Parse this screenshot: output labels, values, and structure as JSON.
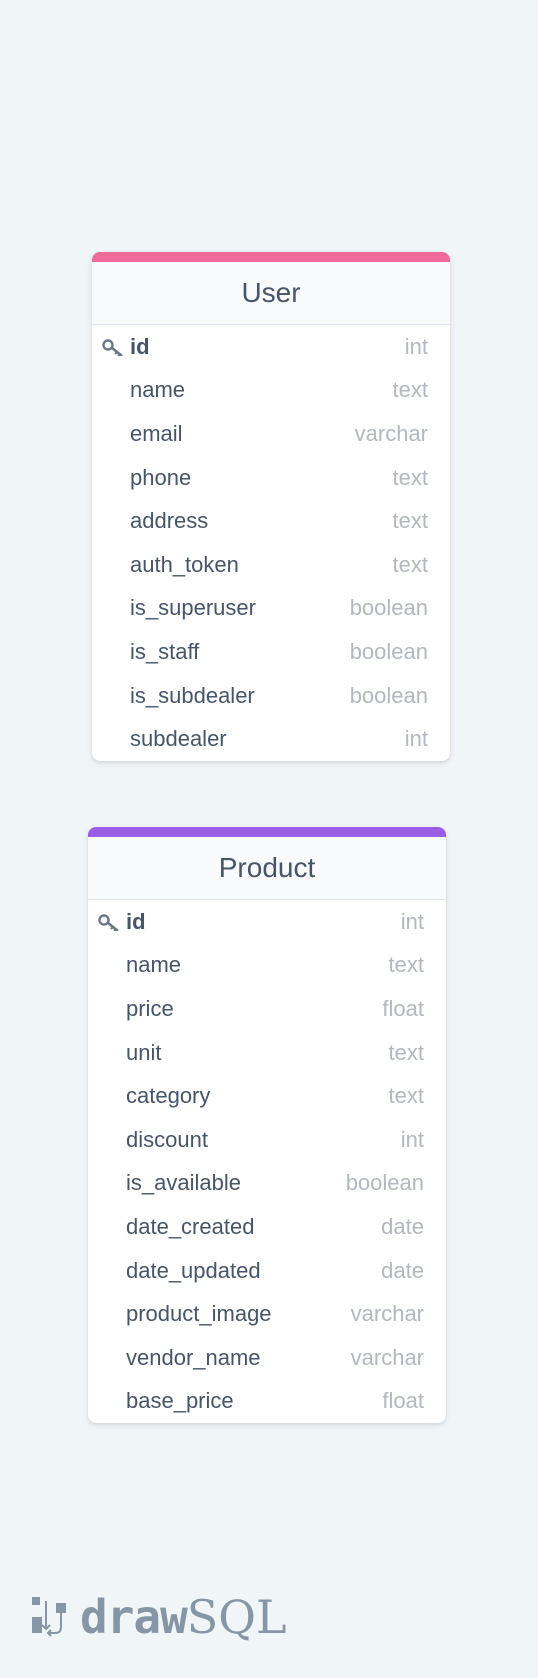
{
  "tables": [
    {
      "name": "User",
      "accent_color": "#f06a99",
      "columns": [
        {
          "name": "id",
          "type": "int",
          "pk": true
        },
        {
          "name": "name",
          "type": "text"
        },
        {
          "name": "email",
          "type": "varchar"
        },
        {
          "name": "phone",
          "type": "text"
        },
        {
          "name": "address",
          "type": "text"
        },
        {
          "name": "auth_token",
          "type": "text"
        },
        {
          "name": "is_superuser",
          "type": "boolean"
        },
        {
          "name": "is_staff",
          "type": "boolean"
        },
        {
          "name": "is_subdealer",
          "type": "boolean"
        },
        {
          "name": "subdealer",
          "type": "int"
        }
      ]
    },
    {
      "name": "Product",
      "accent_color": "#9b5de5",
      "columns": [
        {
          "name": "id",
          "type": "int",
          "pk": true
        },
        {
          "name": "name",
          "type": "text"
        },
        {
          "name": "price",
          "type": "float"
        },
        {
          "name": "unit",
          "type": "text"
        },
        {
          "name": "category",
          "type": "text"
        },
        {
          "name": "discount",
          "type": "int"
        },
        {
          "name": "is_available",
          "type": "boolean"
        },
        {
          "name": "date_created",
          "type": "date"
        },
        {
          "name": "date_updated",
          "type": "date"
        },
        {
          "name": "product_image",
          "type": "varchar"
        },
        {
          "name": "vendor_name",
          "type": "varchar"
        },
        {
          "name": "base_price",
          "type": "float"
        }
      ]
    }
  ],
  "logo": {
    "word_bold": "draw",
    "word_light": "SQL",
    "icon": "drawsql-logo-icon"
  },
  "key_icon": "primary-key-icon"
}
